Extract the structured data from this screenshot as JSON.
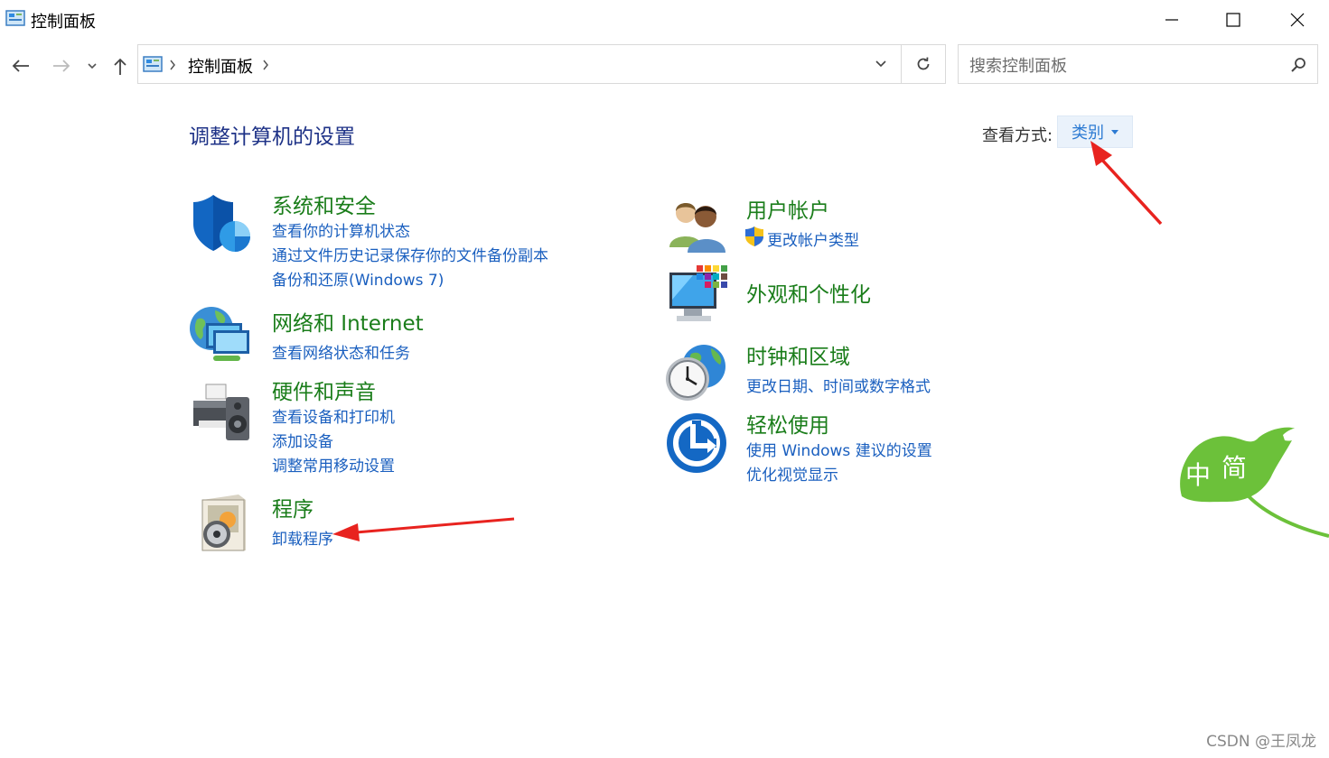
{
  "window": {
    "title": "控制面板",
    "minimize_label": "—",
    "maximize_label": "☐",
    "close_label": "✕"
  },
  "nav": {
    "breadcrumb": [
      "控制面板"
    ],
    "search_placeholder": "搜索控制面板"
  },
  "main": {
    "title": "调整计算机的设置",
    "view_by_label": "查看方式:",
    "view_by_value": "类别",
    "categories": [
      {
        "title": "系统和安全",
        "icon": "shield-icon",
        "links": [
          "查看你的计算机状态",
          "通过文件历史记录保存你的文件备份副本",
          "备份和还原(Windows 7)"
        ]
      },
      {
        "title": "网络和 Internet",
        "icon": "network-globe-icon",
        "links": [
          "查看网络状态和任务"
        ]
      },
      {
        "title": "硬件和声音",
        "icon": "printer-speaker-icon",
        "links": [
          "查看设备和打印机",
          "添加设备",
          "调整常用移动设置"
        ]
      },
      {
        "title": "程序",
        "icon": "programs-disc-icon",
        "links": [
          "卸载程序"
        ]
      },
      {
        "title": "用户帐户",
        "icon": "users-icon",
        "links": [
          "更改帐户类型"
        ]
      },
      {
        "title": "外观和个性化",
        "icon": "monitor-palette-icon",
        "links": []
      },
      {
        "title": "时钟和区域",
        "icon": "clock-globe-icon",
        "links": [
          "更改日期、时间或数字格式"
        ]
      },
      {
        "title": "轻松使用",
        "icon": "ease-of-access-icon",
        "links": [
          "使用 Windows 建议的设置",
          "优化视觉显示"
        ]
      }
    ]
  },
  "overlay": {
    "ime_chars": [
      "中",
      "简"
    ],
    "watermark": "CSDN @王凤龙"
  },
  "colors": {
    "title_blue": "#1e3287",
    "category_green": "#1a7d1a",
    "link_blue": "#1a5fbf",
    "annotation_red": "#e8231f",
    "ime_green": "#6cc13a"
  }
}
